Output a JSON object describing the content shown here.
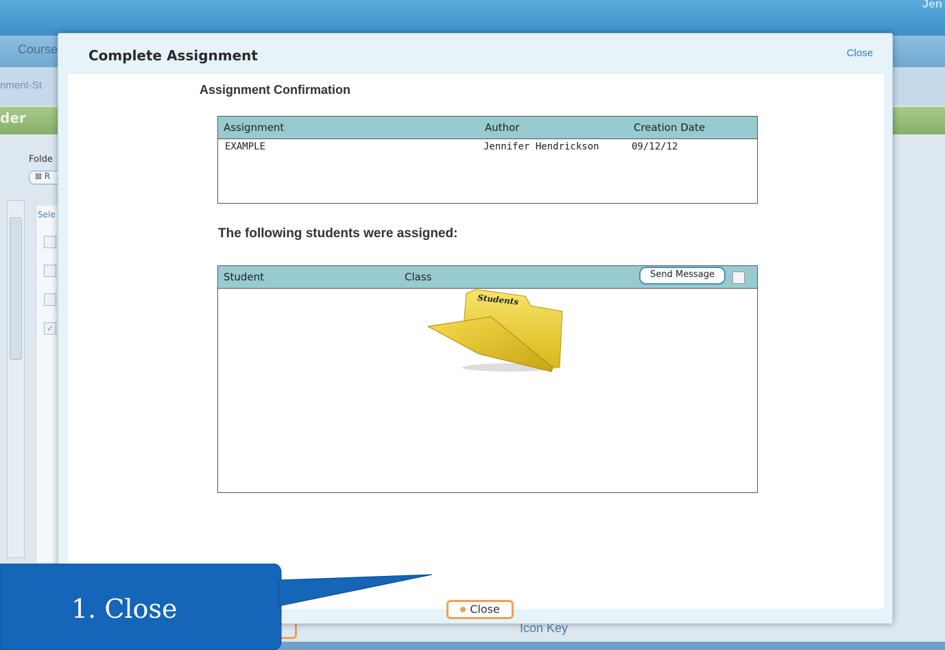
{
  "background": {
    "top_name": "Jen",
    "courses_tab": "Course",
    "sub_link": "nment-St",
    "green_bar": "der",
    "folder_label": "Folde",
    "folder_btn": "R",
    "select_header": "Sele",
    "icon_key": "Icon Key"
  },
  "modal": {
    "title": "Complete Assignment",
    "close_link": "Close",
    "section_title": "Assignment Confirmation",
    "assignment_table": {
      "headers": [
        "Assignment",
        "Author",
        "Creation Date"
      ],
      "rows": [
        [
          "EXAMPLE",
          "Jennifer Hendrickson",
          "09/12/12"
        ]
      ]
    },
    "assigned_title": "The following students were assigned:",
    "students_table": {
      "headers": [
        "Student",
        "Class"
      ],
      "send_message": "Send Message",
      "folder_label": "Students"
    },
    "close_button": "Close"
  },
  "callout": {
    "text": "1. Close"
  },
  "colors": {
    "callout": "#1565b8",
    "accent_orange": "#f0a050",
    "table_header": "#98cbd0"
  }
}
